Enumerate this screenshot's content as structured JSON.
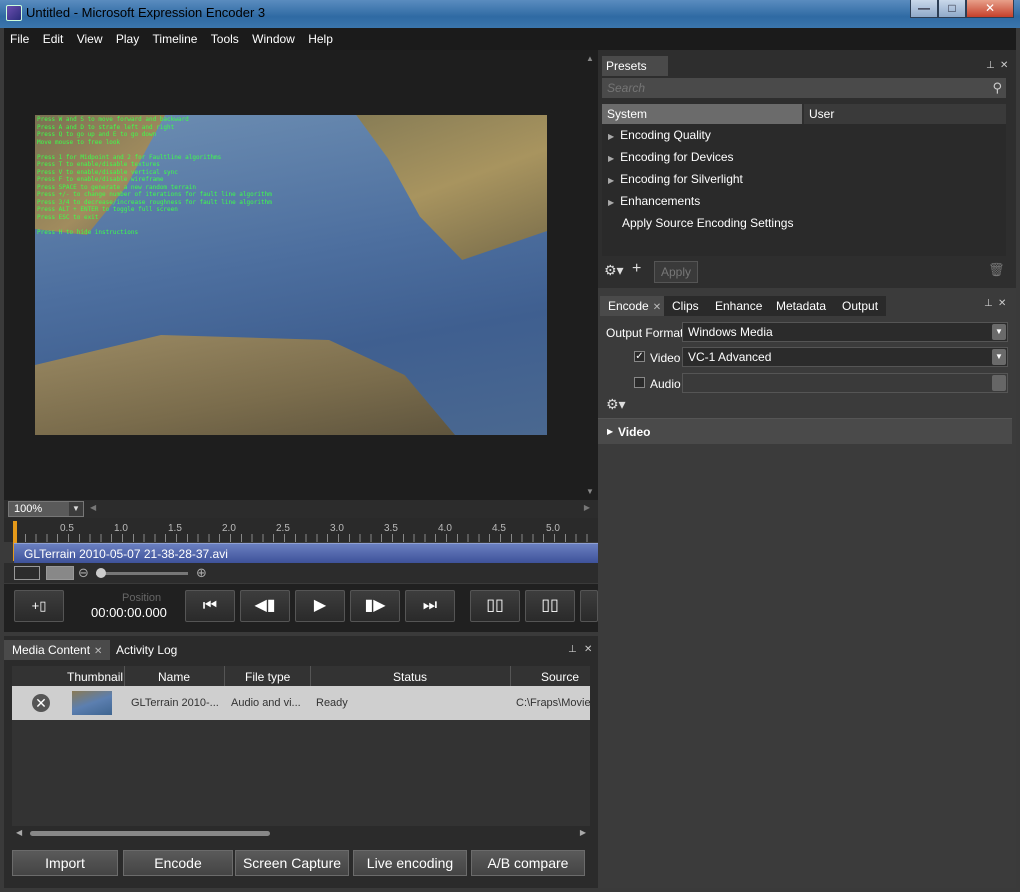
{
  "window": {
    "title": "Untitled - Microsoft Expression Encoder 3",
    "min_glyph": "—",
    "max_glyph": "□",
    "close_glyph": "✕"
  },
  "menu": [
    "File",
    "Edit",
    "View",
    "Play",
    "Timeline",
    "Tools",
    "Window",
    "Help"
  ],
  "viewer": {
    "overlay_lines": [
      "Press W and S to move forward and backward",
      "Press A and D to strafe left and right",
      "Press Q to go up and E to go down",
      "Move mouse to free look",
      "",
      "Press 1 for Midpoint and 2 for Faultline algorithms",
      "Press T to enable/disable textures",
      "Press V to enable/disable vertical sync",
      "Press F to enable/disable wireframe",
      "Press SPACE to generate a new random terrain",
      "Press +/- to change number of iterations for fault line algorithm",
      "Press 3/4 to decrease/increase roughness for fault line algorithm",
      "Press ALT + ENTER to toggle full screen",
      "Press ESC to exit",
      "",
      "Press H to hide instructions"
    ]
  },
  "zoom": {
    "value": "100%"
  },
  "timeline": {
    "ticks": [
      "0.5",
      "1.0",
      "1.5",
      "2.0",
      "2.5",
      "3.0",
      "3.5",
      "4.0",
      "4.5",
      "5.0"
    ],
    "clip_name": "GLTerrain 2010-05-07 21-38-28-37.avi"
  },
  "transport": {
    "position_label": "Position",
    "position_value": "00:00:00.000"
  },
  "bottom": {
    "tabs": [
      "Media Content",
      "Activity Log"
    ],
    "columns": [
      "Thumbnail",
      "Name",
      "File type",
      "Status",
      "Source"
    ],
    "row": {
      "name": "GLTerrain 2010-...",
      "file_type": "Audio and vi...",
      "status": "Ready",
      "source": "C:\\Fraps\\Movie"
    },
    "buttons": [
      "Import",
      "Encode",
      "Screen Capture",
      "Live encoding",
      "A/B compare"
    ]
  },
  "presets": {
    "title": "Presets",
    "search_placeholder": "Search",
    "tabs": [
      "System",
      "User"
    ],
    "items": [
      "Encoding Quality",
      "Encoding for Devices",
      "Encoding for Silverlight",
      "Enhancements"
    ],
    "plain_item": "Apply Source Encoding Settings",
    "apply_label": "Apply"
  },
  "encode": {
    "tabs": [
      "Encode",
      "Clips",
      "Enhance",
      "Metadata",
      "Output"
    ],
    "output_format_label": "Output Format",
    "output_format_value": "Windows Media",
    "video_label": "Video",
    "video_value": "VC-1 Advanced",
    "video_checked": true,
    "audio_label": "Audio",
    "audio_checked": false,
    "section_title": "Video"
  }
}
